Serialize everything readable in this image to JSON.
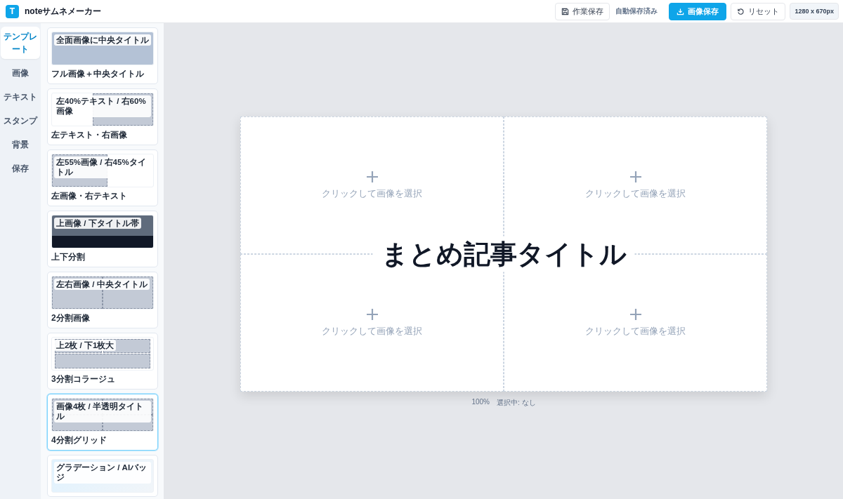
{
  "app": {
    "logo": "T",
    "title": "noteサムネメーカー"
  },
  "toolbar": {
    "save_work": "作業保存",
    "autosave": "自動保存済み",
    "save_image": "画像保存",
    "reset": "リセット",
    "size": "1280 x 670px"
  },
  "nav": [
    {
      "label": "テンプレート",
      "selected": true
    },
    {
      "label": "画像",
      "selected": false
    },
    {
      "label": "テキスト",
      "selected": false
    },
    {
      "label": "スタンプ",
      "selected": false
    },
    {
      "label": "背景",
      "selected": false
    },
    {
      "label": "保存",
      "selected": false
    }
  ],
  "templates": [
    {
      "kind": "full",
      "preview_label": "全面画像に中央タイトル",
      "label": "フル画像＋中央タイトル",
      "selected": false
    },
    {
      "kind": "text-left",
      "preview_label": "左40%テキスト / 右60%画像",
      "label": "左テキスト・右画像",
      "selected": false
    },
    {
      "kind": "image-left",
      "preview_label": "左55%画像 / 右45%タイトル",
      "label": "左画像・右テキスト",
      "selected": false
    },
    {
      "kind": "top-bottom",
      "preview_label": "上画像 / 下タイトル帯",
      "label": "上下分割",
      "selected": false
    },
    {
      "kind": "two",
      "preview_label": "左右画像 / 中央タイトル",
      "label": "2分割画像",
      "selected": false
    },
    {
      "kind": "three",
      "preview_label": "上2枚 / 下1枚大",
      "label": "3分割コラージュ",
      "selected": false
    },
    {
      "kind": "four",
      "preview_label": "画像4枚 / 半透明タイトル",
      "label": "4分割グリッド",
      "selected": true
    },
    {
      "kind": "gradient",
      "preview_label": "グラデーション / AIバッジ",
      "selected": false
    }
  ],
  "canvas": {
    "slots": [
      {
        "hint": "クリックして画像を選択"
      },
      {
        "hint": "クリックして画像を選択"
      },
      {
        "hint": "クリックして画像を選択"
      },
      {
        "hint": "クリックして画像を選択"
      }
    ],
    "title": "まとめ記事タイトル"
  },
  "status": {
    "zoom": "100%",
    "selection": "選択中: なし"
  }
}
